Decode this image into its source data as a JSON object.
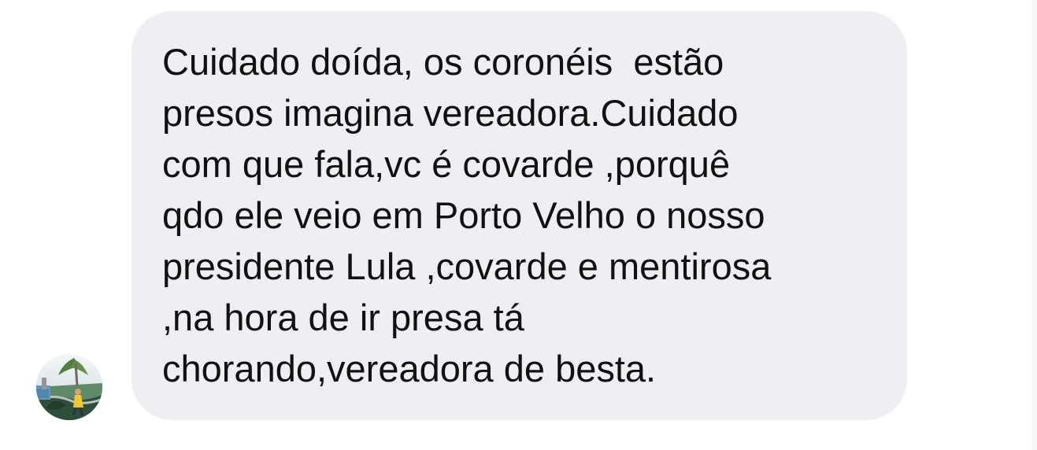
{
  "conversation": {
    "message": {
      "lines": [
        "Cuidado doída, os coronéis  estão",
        "presos imagina vereadora.Cuidado",
        "com que fala,vc é covarde ,porquê",
        "qdo ele veio em Porto Velho o nosso",
        "presidente Lula ,covarde e mentirosa",
        ",na hora de ir presa tá",
        "chorando,vereadora de besta."
      ],
      "avatar_icon": "profile-photo-icon",
      "bubble_color": "#eeeff3",
      "text_color": "#111111"
    }
  }
}
